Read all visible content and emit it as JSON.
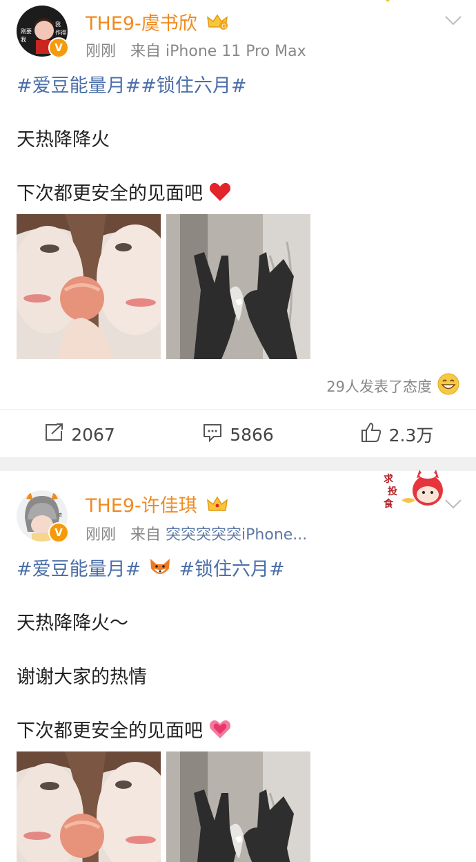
{
  "posts": [
    {
      "username": "THE9-虞书欣",
      "time": "刚刚",
      "source_prefix": "来自",
      "source": "iPhone 11 Pro Max",
      "hashtags": "#爱豆能量月##锁住六月#",
      "lines": [
        "天热降降火",
        "下次都更安全的见面吧"
      ],
      "reactions": "29人发表了态度",
      "repost_count": "2067",
      "comment_count": "5866",
      "like_count": "2.3万",
      "avatar_text": "刚要我 我作得"
    },
    {
      "username": "THE9-许佳琪",
      "time": "刚刚",
      "source_prefix": "来自",
      "source": "突突突突突iPhone...",
      "hashtag_a": "#爱豆能量月#",
      "hashtag_b": "#锁住六月#",
      "lines": [
        "天热降降火～",
        "谢谢大家的热情",
        "下次都更安全的见面吧"
      ],
      "sticker_text": "求 投 食"
    }
  ],
  "icons": {
    "verified": "V",
    "crown": "crown-icon",
    "heart": "heart-icon",
    "pink_heart": "sparkling-heart-icon",
    "fox": "fox-emoji-icon",
    "smile": "grin-emoji-icon",
    "repost": "repost-icon",
    "comment": "comment-icon",
    "like": "thumbs-up-icon",
    "chevron": "chevron-down-icon"
  },
  "colors": {
    "username": "#f08a1e",
    "hashtag": "#4a6ea8",
    "meta": "#888888",
    "verified": "#f59b0b"
  }
}
